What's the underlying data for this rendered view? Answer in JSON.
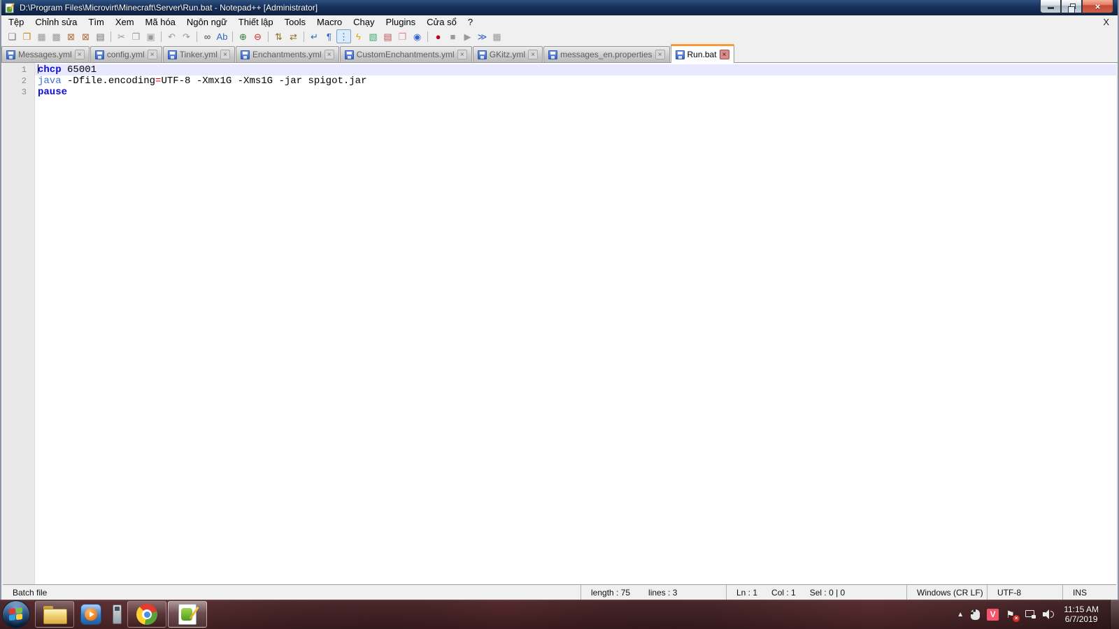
{
  "window": {
    "title": "D:\\Program Files\\Microvirt\\Minecraft\\Server\\Run.bat - Notepad++ [Administrator]",
    "close_glyph": "×"
  },
  "menu": {
    "items": [
      {
        "id": "file",
        "label": "Tệp"
      },
      {
        "id": "edit",
        "label": "Chỉnh sửa"
      },
      {
        "id": "search",
        "label": "Tìm"
      },
      {
        "id": "view",
        "label": "Xem"
      },
      {
        "id": "encoding",
        "label": "Mã hóa"
      },
      {
        "id": "language",
        "label": "Ngôn ngữ"
      },
      {
        "id": "settings",
        "label": "Thiết lập"
      },
      {
        "id": "tools",
        "label": "Tools"
      },
      {
        "id": "macro",
        "label": "Macro"
      },
      {
        "id": "run",
        "label": "Chạy"
      },
      {
        "id": "plugins",
        "label": "Plugins"
      },
      {
        "id": "window",
        "label": "Cửa sổ"
      },
      {
        "id": "help",
        "label": "?"
      }
    ],
    "close_label": "X"
  },
  "toolbar": {
    "groups": [
      [
        {
          "name": "new-file-icon",
          "glyph": "❏",
          "color": "#6f6f6f"
        },
        {
          "name": "open-folder-icon",
          "glyph": "❐",
          "color": "#c8861e"
        },
        {
          "name": "save-icon",
          "glyph": "▦",
          "color": "#9a9a9a"
        },
        {
          "name": "save-all-icon",
          "glyph": "▩",
          "color": "#9a9a9a"
        },
        {
          "name": "close-file-icon",
          "glyph": "⊠",
          "color": "#b06a3a"
        },
        {
          "name": "close-all-icon",
          "glyph": "⊠",
          "color": "#b06a3a"
        },
        {
          "name": "print-icon",
          "glyph": "▤",
          "color": "#6f6f6f"
        }
      ],
      [
        {
          "name": "cut-icon",
          "glyph": "✂",
          "color": "#9a9a9a"
        },
        {
          "name": "copy-icon",
          "glyph": "❐",
          "color": "#9a9a9a"
        },
        {
          "name": "paste-icon",
          "glyph": "▣",
          "color": "#9a9a9a"
        }
      ],
      [
        {
          "name": "undo-icon",
          "glyph": "↶",
          "color": "#9a9a9a"
        },
        {
          "name": "redo-icon",
          "glyph": "↷",
          "color": "#9a9a9a"
        }
      ],
      [
        {
          "name": "find-icon",
          "glyph": "∞",
          "color": "#3f3f3f"
        },
        {
          "name": "replace-icon",
          "glyph": "Ab",
          "color": "#2f66b8"
        }
      ],
      [
        {
          "name": "zoom-in-icon",
          "glyph": "⊕",
          "color": "#2e7d32"
        },
        {
          "name": "zoom-out-icon",
          "glyph": "⊖",
          "color": "#c62828"
        }
      ],
      [
        {
          "name": "sync-vertical-scroll-icon",
          "glyph": "⇅",
          "color": "#8a6d1a"
        },
        {
          "name": "sync-horizontal-scroll-icon",
          "glyph": "⇄",
          "color": "#8a6d1a"
        }
      ],
      [
        {
          "name": "word-wrap-icon",
          "glyph": "↵",
          "color": "#2f66b8"
        },
        {
          "name": "show-all-characters-icon",
          "glyph": "¶",
          "color": "#2b5fc0"
        },
        {
          "name": "show-indent-guide-icon",
          "glyph": "⋮",
          "color": "#2b5fc0",
          "pressed": true
        },
        {
          "name": "function-list-icon",
          "glyph": "ϟ",
          "color": "#e0a000"
        },
        {
          "name": "document-map-icon",
          "glyph": "▧",
          "color": "#44aa77"
        },
        {
          "name": "document-list-icon",
          "glyph": "▤",
          "color": "#c05555"
        },
        {
          "name": "folder-as-workspace-icon",
          "glyph": "❒",
          "color": "#d98c8c"
        },
        {
          "name": "document-monitor-icon",
          "glyph": "◉",
          "color": "#3366cc"
        }
      ],
      [
        {
          "name": "macro-record-icon",
          "glyph": "●",
          "color": "#c00020"
        },
        {
          "name": "macro-stop-icon",
          "glyph": "■",
          "color": "#9a9a9a"
        },
        {
          "name": "macro-play-icon",
          "glyph": "▶",
          "color": "#9a9a9a"
        },
        {
          "name": "macro-run-multiple-icon",
          "glyph": "≫",
          "color": "#2b5fc0"
        },
        {
          "name": "macro-save-icon",
          "glyph": "▦",
          "color": "#9a9a9a"
        }
      ]
    ]
  },
  "tabs": {
    "items": [
      {
        "label": "Messages.yml",
        "active": false
      },
      {
        "label": "config.yml",
        "active": false
      },
      {
        "label": "Tinker.yml",
        "active": false
      },
      {
        "label": "Enchantments.yml",
        "active": false
      },
      {
        "label": "CustomEnchantments.yml",
        "active": false
      },
      {
        "label": "GKitz.yml",
        "active": false
      },
      {
        "label": "messages_en.properties",
        "active": false
      },
      {
        "label": "Run.bat",
        "active": true
      }
    ],
    "close_glyph": "×",
    "active_accent_color": "#fa9833"
  },
  "editor": {
    "current_line_color": "#e8e8ff",
    "lines": [
      {
        "num": "1",
        "current": true,
        "caret": true,
        "tokens": [
          {
            "text": "chcp",
            "style": "keyword"
          },
          {
            "text": " 65001",
            "style": "plain"
          }
        ]
      },
      {
        "num": "2",
        "current": false,
        "caret": false,
        "tokens": [
          {
            "text": "java",
            "style": "command"
          },
          {
            "text": " -Dfile.encoding",
            "style": "plain"
          },
          {
            "text": "=",
            "style": "operator"
          },
          {
            "text": "UTF-8 -Xmx1G -Xms1G -jar spigot.jar",
            "style": "plain"
          }
        ]
      },
      {
        "num": "3",
        "current": false,
        "caret": false,
        "tokens": [
          {
            "text": "pause",
            "style": "keyword"
          }
        ]
      }
    ]
  },
  "statusbar": {
    "doc_type": "Batch file",
    "length_label": "length : 75",
    "lines_label": "lines : 3",
    "ln_label": "Ln : 1",
    "col_label": "Col : 1",
    "sel_label": "Sel : 0 | 0",
    "eol": "Windows (CR LF)",
    "encoding": "UTF-8",
    "insert_mode": "INS"
  },
  "taskbar": {
    "icons": [
      "start",
      "windows-explorer",
      "windows-media-player",
      "calculator",
      "chrome",
      "notepad-plus-plus"
    ],
    "tray_icons": [
      "hidden-icons-arrow",
      "mouse-utility",
      "v-app",
      "action-center-flag",
      "network",
      "volume"
    ],
    "clock": {
      "time": "11:15 AM",
      "date": "6/7/2019"
    }
  }
}
